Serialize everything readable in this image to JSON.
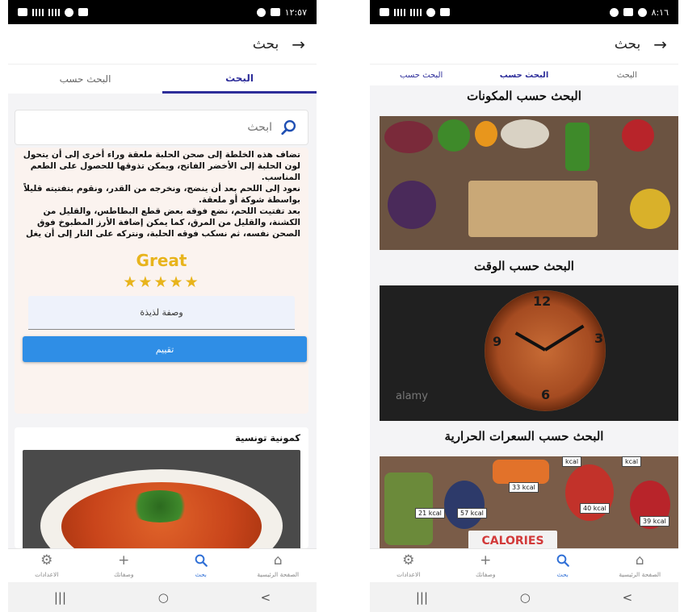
{
  "left_phone": {
    "status_time": "١٢:٥٧",
    "app_title": "بحث",
    "tabs": [
      {
        "label": "البحث حسب"
      },
      {
        "label": "البحث"
      }
    ],
    "search": {
      "placeholder": "ابحث"
    },
    "recipe_text": "تضاف هذه الخلطة إلى صحن الحلبة ملعقة وراء أخرى إلى أن يتحول لون الحلبة إلى الأخضر الفاتح، ويمكن تذوقها للحصول على الطعم المناسب.\nنعود إلى اللحم بعد أن ينضج، ونخرجه من القدر، ونقوم بتفتيته قليلاً بواسطة شوكة أو ملعقة.\nبعد تفتيت اللحم، نضع فوقه بعض قطع البطاطس، والقليل من الكشنة، والقليل من المرق، كما يمكن إضافة الأرز المطبوخ فوق الصحن نفسه، ثم نسكب فوقه الحلبة، ونتركه على النار إلى أن يغل",
    "rating_label": "Great",
    "rating_value": 5,
    "rating_max": 5,
    "comment_value": "وصفة لذيذة",
    "rate_button": "تقييم",
    "dish_title": "كمونية تونسية"
  },
  "right_phone": {
    "status_time": "٨:١٦",
    "app_title": "بحث",
    "tabs": [
      {
        "label": "البحث"
      },
      {
        "label": "البحث حسب"
      },
      {
        "label": "البحث حسب"
      }
    ],
    "sections": [
      {
        "title": "البحث حسب المكونات"
      },
      {
        "title": "البحث حسب الوقت"
      },
      {
        "title": "البحث حسب السعرات الحرارية"
      }
    ],
    "calorie_tags": [
      "33 kcal",
      "21 kcal",
      "57 kcal",
      "40 kcal",
      "39 kcal",
      "kcal",
      "kcal"
    ],
    "calories_sign": "CALORIES",
    "watermark": "alamy"
  },
  "bottom_nav": [
    {
      "label": "الاعدادات",
      "icon": "gear-icon"
    },
    {
      "label": "وصفاتك",
      "icon": "plus-icon"
    },
    {
      "label": "بحث",
      "icon": "search-icon"
    },
    {
      "label": "الصفحة الرئيسية",
      "icon": "home-icon"
    }
  ],
  "system_nav": {
    "recents": "|||",
    "home": "○",
    "back": "<"
  },
  "colors": {
    "accent": "#2d2d9a",
    "button": "#2f8ee6",
    "star": "#e8b41c",
    "active_nav": "#2f6fd6"
  }
}
